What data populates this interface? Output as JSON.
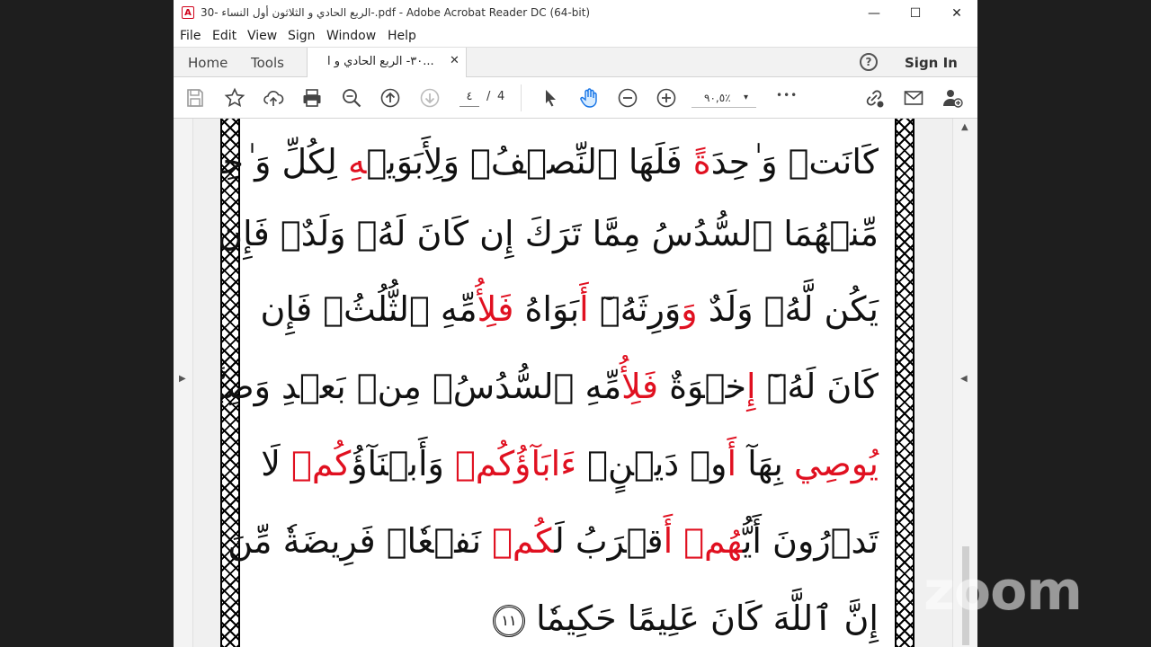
{
  "window": {
    "title": "30- الربع الحادي و الثلاثون أول النساء-.pdf - Adobe Acrobat Reader DC (64-bit)",
    "app_icon": "acrobat-icon",
    "controls": {
      "minimize": "—",
      "maximize": "☐",
      "close": "✕"
    }
  },
  "menu": [
    "File",
    "Edit",
    "View",
    "Sign",
    "Window",
    "Help"
  ],
  "tabs": {
    "home": "Home",
    "tools": "Tools",
    "document": "٣٠- الربع الحادي و ا...",
    "close": "✕"
  },
  "header": {
    "help_icon": "?",
    "sign_in": "Sign In"
  },
  "toolbar": {
    "page_current": "٤",
    "page_separator": "/",
    "page_total": "4",
    "zoom": "٩٠,٥٪",
    "zoom_caret": "▾",
    "more": "•••",
    "icons": [
      "save-icon",
      "star-icon",
      "upload-icon",
      "print-icon",
      "search-zoom-icon",
      "page-up-icon",
      "page-down-icon",
      "select-cursor-icon",
      "hand-tool-icon",
      "zoom-out-icon",
      "zoom-in-icon",
      "more-icon",
      "share-link-icon",
      "email-icon",
      "add-user-icon"
    ]
  },
  "verses": {
    "line1": {
      "a": "كَانَتۡ وَ ٰحِدَ",
      "b": "ةً",
      "c": " فَلَهَا ٱلنِّصۡفُۚ وَلِأَبَوَيۡ",
      "d": "هِ",
      "e": " لِكُلِّ وَ ٰحِدٍ"
    },
    "line2": "مِّنۡهُمَا ٱلسُّدُسُ مِمَّا تَرَكَ إِن كَانَ لَهُۥ وَلَدٌۚ فَإِن لَّمۡ",
    "line3": {
      "a": "يَكُن لَّهُۥ وَلَدٌ ",
      "b": "وَ",
      "c": "وَرِثَهُۥٓ ",
      "d": "أَ",
      "e": "بَوَاهُ ",
      "f": "فَلِأُ",
      "g": "مِّهِ ٱلثُّلُثُۚ فَإِن"
    },
    "line4": {
      "a": "كَانَ لَهُۥٓ ",
      "b": "إِ",
      "c": "خۡوَةٌ ",
      "d": "فَلِأُ",
      "e": "مِّهِ ٱلسُّدُسُۚ مِنۢ بَعۡدِ وَصِيَّةٖ"
    },
    "line5": {
      "a": "يُوصِي",
      "b": " بِهَآ ",
      "c": "أَ",
      "d": "وۡ دَيۡنٍۗ ",
      "e": "ءَابَآؤُ",
      "f": "كُمۡ",
      "g": " وَأَبۡنَآؤُ",
      "h": "كُمۡ",
      "i": " لَا"
    },
    "line6": {
      "a": "تَدۡرُونَ أَيُّ",
      "b": "هُمۡ",
      "c": " ",
      "d": "أَ",
      "e": "قۡرَبُ لَ",
      "f": "كُمۡ",
      "g": " نَفۡعٗاۚ فَرِيضَةٗ مِّنَ ٱللَّهِۗ"
    },
    "line7": "إِنَّ ٱللَّهَ كَانَ عَلِيمًا حَكِيمٗا",
    "ayah_number": "١١"
  },
  "watermark": "zoom",
  "colors": {
    "highlight": "#e01020",
    "text": "#111111",
    "background": "#1e1e1e"
  }
}
